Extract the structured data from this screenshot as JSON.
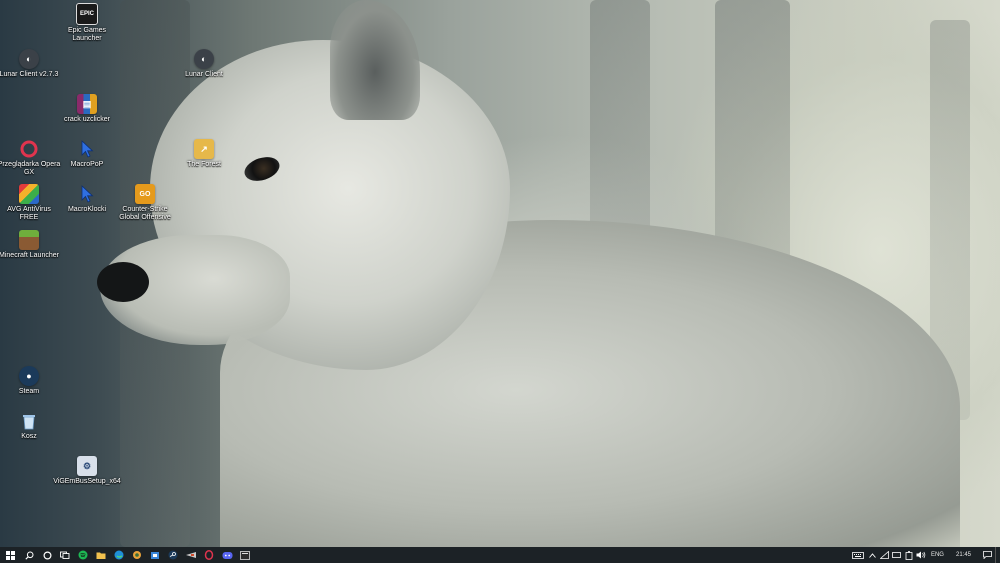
{
  "desktop_icons": [
    {
      "label": "Epic Games Launcher",
      "icon": "epic-games-icon",
      "color": "#1a1a1a"
    },
    {
      "label": "Lunar Client v2.7.3",
      "icon": "lunar-client-icon",
      "color": "#3b4148"
    },
    {
      "label": "Lunar Client",
      "icon": "lunar-client-icon",
      "color": "#3b4148"
    },
    {
      "label": "crack uzclicker",
      "icon": "winrar-archive-icon",
      "color": "#8a2a6a"
    },
    {
      "label": "Przeglądarka Opera GX",
      "icon": "opera-gx-icon",
      "color": "#e0344e"
    },
    {
      "label": "MacroPoP",
      "icon": "cursor-icon",
      "color": "#2f6fe0"
    },
    {
      "label": "The Forest",
      "icon": "folder-shortcut-icon",
      "color": "#e6b84a"
    },
    {
      "label": "AVG AntiVirus FREE",
      "icon": "avg-antivirus-icon",
      "color": "#2b69c9"
    },
    {
      "label": "MacroKlocki",
      "icon": "cursor-icon",
      "color": "#2f6fe0"
    },
    {
      "label": "Counter-Strike Global Offensive",
      "icon": "csgo-icon",
      "color": "#e59a1c"
    },
    {
      "label": "Minecraft Launcher",
      "icon": "minecraft-block-icon",
      "color": "#5d8a3a"
    },
    {
      "label": "Steam",
      "icon": "steam-icon",
      "color": "#1b3a5a"
    },
    {
      "label": "Kosz",
      "icon": "recycle-bin-icon",
      "color": "#9ec4e8"
    },
    {
      "label": "ViGEmBusSetup_x64",
      "icon": "installer-icon",
      "color": "#6b88b0"
    }
  ],
  "taskbar": {
    "apps": [
      {
        "name": "start-button",
        "icon": "windows-logo-icon"
      },
      {
        "name": "search-button",
        "icon": "search-icon"
      },
      {
        "name": "cortana-button",
        "icon": "cortana-ring-icon"
      },
      {
        "name": "task-view-button",
        "icon": "task-view-icon"
      },
      {
        "name": "spotify-button",
        "icon": "spotify-icon"
      },
      {
        "name": "file-explorer-button",
        "icon": "folder-icon"
      },
      {
        "name": "edge-button",
        "icon": "edge-icon"
      },
      {
        "name": "app-button-1",
        "icon": "generic-app-icon"
      },
      {
        "name": "app-button-2",
        "icon": "store-icon"
      },
      {
        "name": "steam-button",
        "icon": "steam-icon"
      },
      {
        "name": "app-button-3",
        "icon": "game-icon"
      },
      {
        "name": "opera-gx-button",
        "icon": "opera-gx-icon"
      },
      {
        "name": "discord-button",
        "icon": "discord-icon"
      },
      {
        "name": "app-button-4",
        "icon": "terminal-icon"
      }
    ],
    "tray": {
      "language": "ENG",
      "time": "21:45"
    }
  },
  "colors": {
    "taskbar_bg": "#1c2226",
    "accent": "#2f6fe0"
  }
}
